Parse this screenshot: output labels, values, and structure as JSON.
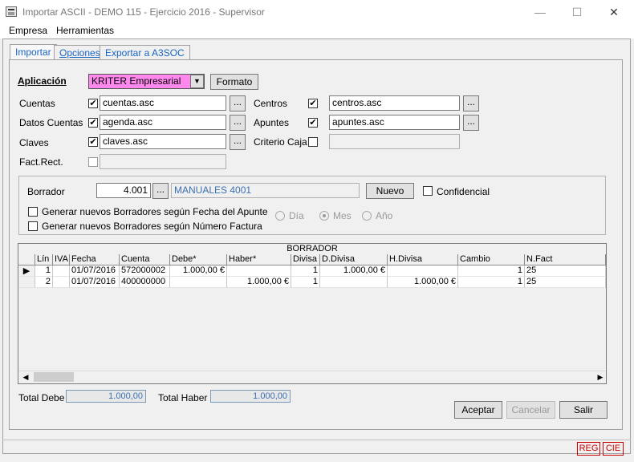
{
  "window": {
    "title": "Importar ASCII - DEMO 115 - Ejercicio 2016 - Supervisor",
    "min": "—",
    "max": "☐",
    "close": "✕"
  },
  "menu": {
    "empresa": "Empresa",
    "herramientas": "Herramientas"
  },
  "tabs": [
    {
      "label": "Importar"
    },
    {
      "label": "Opciones"
    },
    {
      "label": "Exportar a A3SOC"
    }
  ],
  "import": {
    "aplicacion_label": "Aplicación",
    "aplicacion_value": "KRITER Empresarial",
    "formato_label": "Formato",
    "browse": "...",
    "cuentas": {
      "label": "Cuentas",
      "checked": true,
      "value": "cuentas.asc"
    },
    "datos_cuentas": {
      "label": "Datos Cuentas",
      "checked": true,
      "value": "agenda.asc"
    },
    "claves": {
      "label": "Claves",
      "checked": true,
      "value": "claves.asc"
    },
    "fact_rect": {
      "label": "Fact.Rect.",
      "checked": false,
      "value": ""
    },
    "centros": {
      "label": "Centros",
      "checked": true,
      "value": "centros.asc"
    },
    "apuntes": {
      "label": "Apuntes",
      "checked": true,
      "value": "apuntes.asc"
    },
    "criterio_caja": {
      "label": "Criterio Caja",
      "checked": false,
      "value": ""
    }
  },
  "borrador": {
    "label": "Borrador",
    "value": "4.001",
    "desc": "MANUALES 4001",
    "nuevo_label": "Nuevo",
    "confidencial_label": "Confidencial",
    "opt_fecha": "Generar nuevos Borradores según Fecha del Apunte",
    "opt_numero": "Generar nuevos Borradores según Número Factura",
    "radio_dia": "Día",
    "radio_mes": "Mes",
    "radio_anio": "Año"
  },
  "grid": {
    "title": "BORRADOR",
    "columns": [
      "Lín",
      "IVA",
      "Fecha",
      "Cuenta",
      "Debe*",
      "Haber*",
      "Divisa",
      "D.Divisa",
      "H.Divisa",
      "Cambio",
      "N.Fact"
    ],
    "rows": [
      {
        "lin": "1",
        "iva": "",
        "fecha": "01/07/2016",
        "cuenta": "572000002",
        "debe": "1.000,00 €",
        "haber": "",
        "divisa": "1",
        "ddivisa": "1.000,00 €",
        "hdivisa": "",
        "cambio": "1",
        "nfact": "25"
      },
      {
        "lin": "2",
        "iva": "",
        "fecha": "01/07/2016",
        "cuenta": "400000000",
        "debe": "",
        "haber": "1.000,00 €",
        "divisa": "1",
        "ddivisa": "",
        "hdivisa": "1.000,00 €",
        "cambio": "1",
        "nfact": "25"
      }
    ]
  },
  "totals": {
    "debe_label": "Total Debe",
    "debe_value": "1.000,00",
    "haber_label": "Total Haber",
    "haber_value": "1.000,00"
  },
  "buttons": {
    "aceptar": "Aceptar",
    "cancelar": "Cancelar",
    "salir": "Salir"
  },
  "status": {
    "reg": "REG",
    "cie": "CIE"
  },
  "colors": {
    "combo_bg": "#ff88ee",
    "link_blue": "#1a64c0"
  }
}
